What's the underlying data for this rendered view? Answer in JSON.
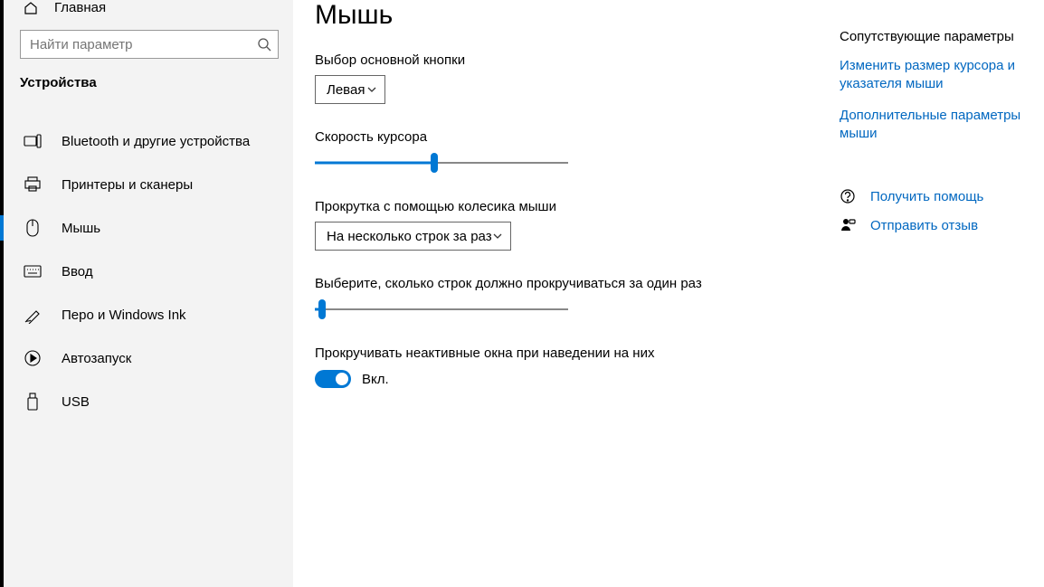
{
  "sidebar": {
    "home_label": "Главная",
    "search_placeholder": "Найти параметр",
    "section_title": "Устройства",
    "items": [
      {
        "label": "Bluetooth и другие устройства"
      },
      {
        "label": "Принтеры и сканеры"
      },
      {
        "label": "Мышь"
      },
      {
        "label": "Ввод"
      },
      {
        "label": "Перо и Windows Ink"
      },
      {
        "label": "Автозапуск"
      },
      {
        "label": "USB"
      }
    ]
  },
  "main": {
    "title": "Мышь",
    "primary_button": {
      "label": "Выбор основной кнопки",
      "value": "Левая"
    },
    "cursor_speed": {
      "label": "Скорость курсора",
      "percent": 47
    },
    "scroll_mode": {
      "label": "Прокрутка с помощью колесика мыши",
      "value": "На несколько строк за раз"
    },
    "scroll_lines": {
      "label": "Выберите, сколько строк должно прокручиваться за один раз",
      "percent": 3
    },
    "inactive_scroll": {
      "label": "Прокручивать неактивные окна при наведении на них",
      "state_label": "Вкл."
    }
  },
  "aside": {
    "title": "Сопутствующие параметры",
    "links": [
      "Изменить размер курсора и указателя мыши",
      "Дополнительные параметры мыши"
    ],
    "help": "Получить помощь",
    "feedback": "Отправить отзыв"
  }
}
